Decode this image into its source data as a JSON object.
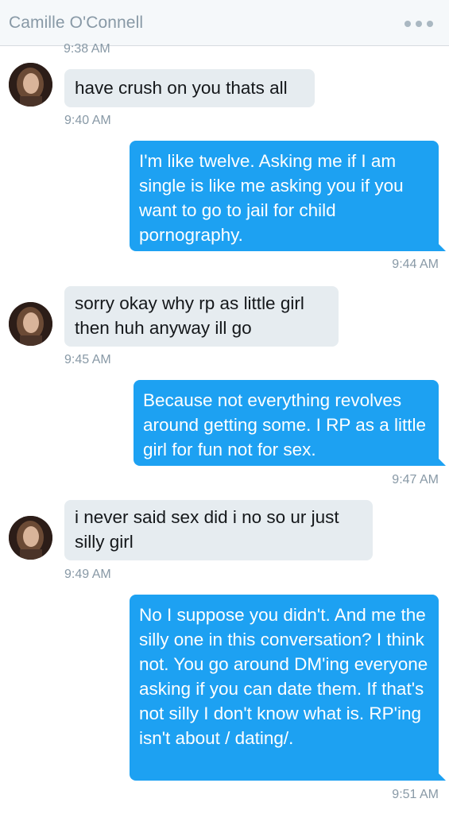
{
  "header": {
    "title": "Camille O'Connell",
    "more_icon": "more-dots-icon"
  },
  "colors": {
    "outgoing_bubble": "#1da1f2",
    "incoming_bubble": "#e6ecf0",
    "timestamp": "#8899a6"
  },
  "messages": [
    {
      "direction": "in",
      "text": "have crush on you thats all",
      "time": "9:40 AM"
    },
    {
      "direction": "out",
      "text": "I'm like twelve. Asking me if I am single is like me asking you if you want to go to jail for child pornography.",
      "time": "9:44 AM"
    },
    {
      "direction": "in",
      "text": "sorry okay why rp as little girl then huh anyway ill go",
      "time": "9:45 AM"
    },
    {
      "direction": "out",
      "text": "Because not everything revolves around getting some. I RP as a little girl for fun not for sex.",
      "time": "9:47 AM"
    },
    {
      "direction": "in",
      "text": "i never said sex did i no so ur just silly girl",
      "time": "9:49 AM"
    },
    {
      "direction": "out",
      "text": "No I suppose you didn't. And me the silly one in this conversation? I think not. You go around DM'ing everyone asking if you can date them. If that's not silly I don't know what is. RP'ing isn't about / dating/.",
      "time": "9:51 AM"
    }
  ],
  "previous_time": "9:38 AM"
}
